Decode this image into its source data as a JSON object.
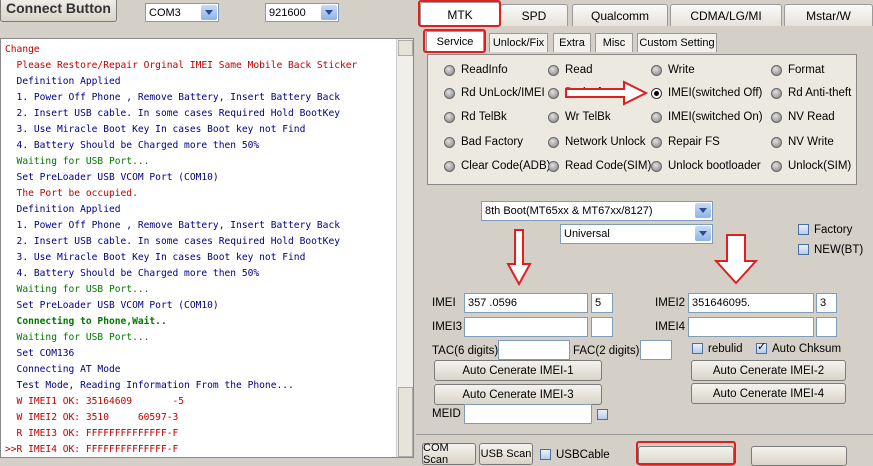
{
  "toolbar": {
    "connect_label": "Connect Button",
    "com_port": "COM3",
    "baud_rate": "921600"
  },
  "log": [
    {
      "text": "Change",
      "color": "c-red"
    },
    {
      "text": "  Please Restore/Repair Orginal IMEI Same Mobile Back Sticker",
      "color": "c-red"
    },
    {
      "text": "  Definition Applied",
      "color": "c-blue"
    },
    {
      "text": "  1. Power Off Phone , Remove Battery, Insert Battery Back",
      "color": "c-blue"
    },
    {
      "text": "  2. Insert USB cable. In some cases Required Hold BootKey",
      "color": "c-blue"
    },
    {
      "text": "  3. Use Miracle Boot Key In cases Boot key not Find",
      "color": "c-blue"
    },
    {
      "text": "  4. Battery Should be Charged more then 50%",
      "color": "c-blue"
    },
    {
      "text": "  Waiting for USB Port...",
      "color": "c-green"
    },
    {
      "text": "  Set PreLoader USB VCOM Port (COM10)",
      "color": "c-blue"
    },
    {
      "text": "  The Port be occupied.",
      "color": "c-red"
    },
    {
      "text": "  Definition Applied",
      "color": "c-blue"
    },
    {
      "text": "  1. Power Off Phone , Remove Battery, Insert Battery Back",
      "color": "c-blue"
    },
    {
      "text": "  2. Insert USB cable. In some cases Required Hold BootKey",
      "color": "c-blue"
    },
    {
      "text": "  3. Use Miracle Boot Key In cases Boot key not Find",
      "color": "c-blue"
    },
    {
      "text": "  4. Battery Should be Charged more then 50%",
      "color": "c-blue"
    },
    {
      "text": "  Waiting for USB Port...",
      "color": "c-green"
    },
    {
      "text": "  Set PreLoader USB VCOM Port (COM10)",
      "color": "c-blue"
    },
    {
      "text": "  Connecting to Phone,Wait..",
      "color": "c-bold-green"
    },
    {
      "text": "  Waiting for USB Port...",
      "color": "c-green"
    },
    {
      "text": "  Set COM136",
      "color": "c-blue"
    },
    {
      "text": "  Connecting AT Mode",
      "color": "c-blue"
    },
    {
      "text": "  Test Mode, Reading Information From the Phone...",
      "color": "c-blue"
    },
    {
      "text": "  W IMEI1 OK: 35164609       -5",
      "color": "c-red"
    },
    {
      "text": "  W IMEI2 OK: 3510     60597-3",
      "color": "c-red"
    },
    {
      "text": "  R IMEI3 OK: FFFFFFFFFFFFFF-F",
      "color": "c-red"
    },
    {
      "text": ">>R IMEI4 OK: FFFFFFFFFFFFFF-F",
      "color": "c-red"
    }
  ],
  "main_tabs": [
    "MTK",
    "SPD",
    "Qualcomm",
    "CDMA/LG/MI",
    "Mstar/W"
  ],
  "sub_tabs": [
    "Service",
    "Unlock/Fix",
    "Extra",
    "Misc",
    "Custom Setting"
  ],
  "options": [
    [
      "ReadInfo",
      "Read",
      "Write",
      "Format"
    ],
    [
      "Rd UnLock/IMEI",
      "Badsoftware",
      "IMEI(switched Off)",
      "Rd Anti-theft"
    ],
    [
      "Rd TelBk",
      "Wr TelBk",
      "IMEI(switched On)",
      "NV Read"
    ],
    [
      "Bad Factory",
      "Network Unlock",
      "Repair FS",
      "NV Write"
    ],
    [
      "Clear Code(ADB)",
      "Read Code(SIM)",
      "Unlock bootloader",
      "Unlock(SIM)"
    ]
  ],
  "boot_select": "8th Boot(MT65xx & MT67xx/8127)",
  "model_select": "Universal",
  "factory_label": "Factory",
  "newbt_label": "NEW(BT)",
  "imei": {
    "imei1_label": "IMEI",
    "imei1_value": "357          .0596",
    "imei1_check": "5",
    "imei2_label": "IMEI2",
    "imei2_value": "351646095.",
    "imei2_check": "3",
    "imei3_label": "IMEI3",
    "imei4_label": "IMEI4",
    "tac_label": "TAC(6 digits):",
    "fac_label": "FAC(2 digits):",
    "rebulid_label": "rebulid",
    "auto_chksum_label": "Auto Chksum",
    "gen1": "Auto Cenerate IMEI-1",
    "gen2": "Auto Cenerate IMEI-2",
    "gen3": "Auto Cenerate IMEI-3",
    "gen4": "Auto Cenerate IMEI-4",
    "meid_label": "MEID"
  },
  "bottom": {
    "com_scan": "COM Scan",
    "usb_scan": "USB Scan",
    "usb_cable": "USBCable"
  }
}
